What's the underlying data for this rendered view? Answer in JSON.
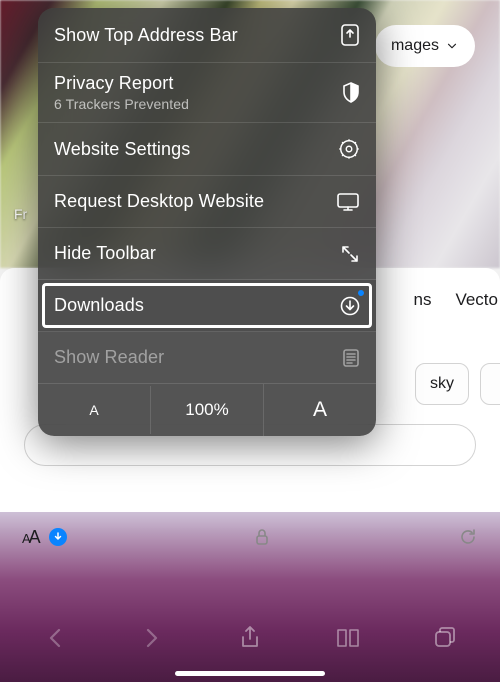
{
  "background": {
    "pill_label": "mages",
    "free_badge": "Fr",
    "tabs": {
      "right1": "ns",
      "right2": "Vecto"
    },
    "chips": {
      "sky": "sky"
    }
  },
  "menu": {
    "show_address": "Show Top Address Bar",
    "privacy": {
      "title": "Privacy Report",
      "subtitle": "6 Trackers Prevented"
    },
    "website_settings": "Website Settings",
    "request_desktop": "Request Desktop Website",
    "hide_toolbar": "Hide Toolbar",
    "downloads": "Downloads",
    "show_reader": "Show Reader",
    "zoom": {
      "small": "A",
      "value": "100%",
      "large": "A"
    }
  },
  "addrbar": {
    "aa": "AA"
  },
  "colors": {
    "accent": "#0a84ff"
  }
}
